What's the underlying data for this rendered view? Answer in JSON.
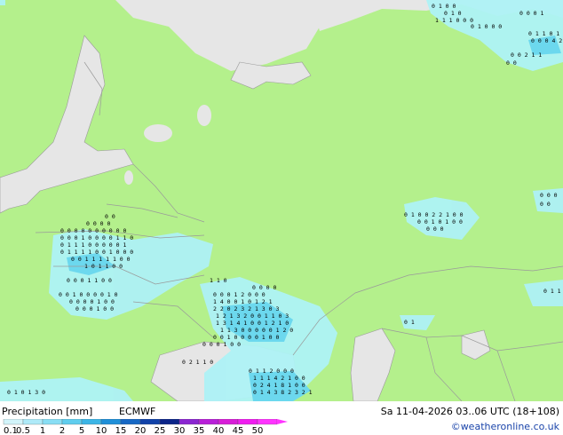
{
  "title": "Precipitation [mm]",
  "model": "ECMWF",
  "datetime": "Sa 11-04-2026 03..06 UTC (18+108)",
  "credit": "©weatheronline.co.uk",
  "legend": {
    "labels": [
      "0.1",
      "0.5",
      "1",
      "2",
      "5",
      "10",
      "15",
      "20",
      "25",
      "30",
      "35",
      "40",
      "45",
      "50"
    ],
    "colors": [
      "#d2f4fa",
      "#aeeaf8",
      "#88def4",
      "#5fcdee",
      "#3cb5e6",
      "#1f8fd8",
      "#1768c4",
      "#1142a8",
      "#0b2488",
      "#8a26d0",
      "#b820d8",
      "#d81ed8",
      "#f01ef0",
      "#ff34ff"
    ]
  },
  "colors": {
    "land": "#b4f08c",
    "sea": "#e6e6e6",
    "border": "#9a9a9a",
    "precip_light": "#aef2f6",
    "precip_mid": "#6cd8ee"
  }
}
